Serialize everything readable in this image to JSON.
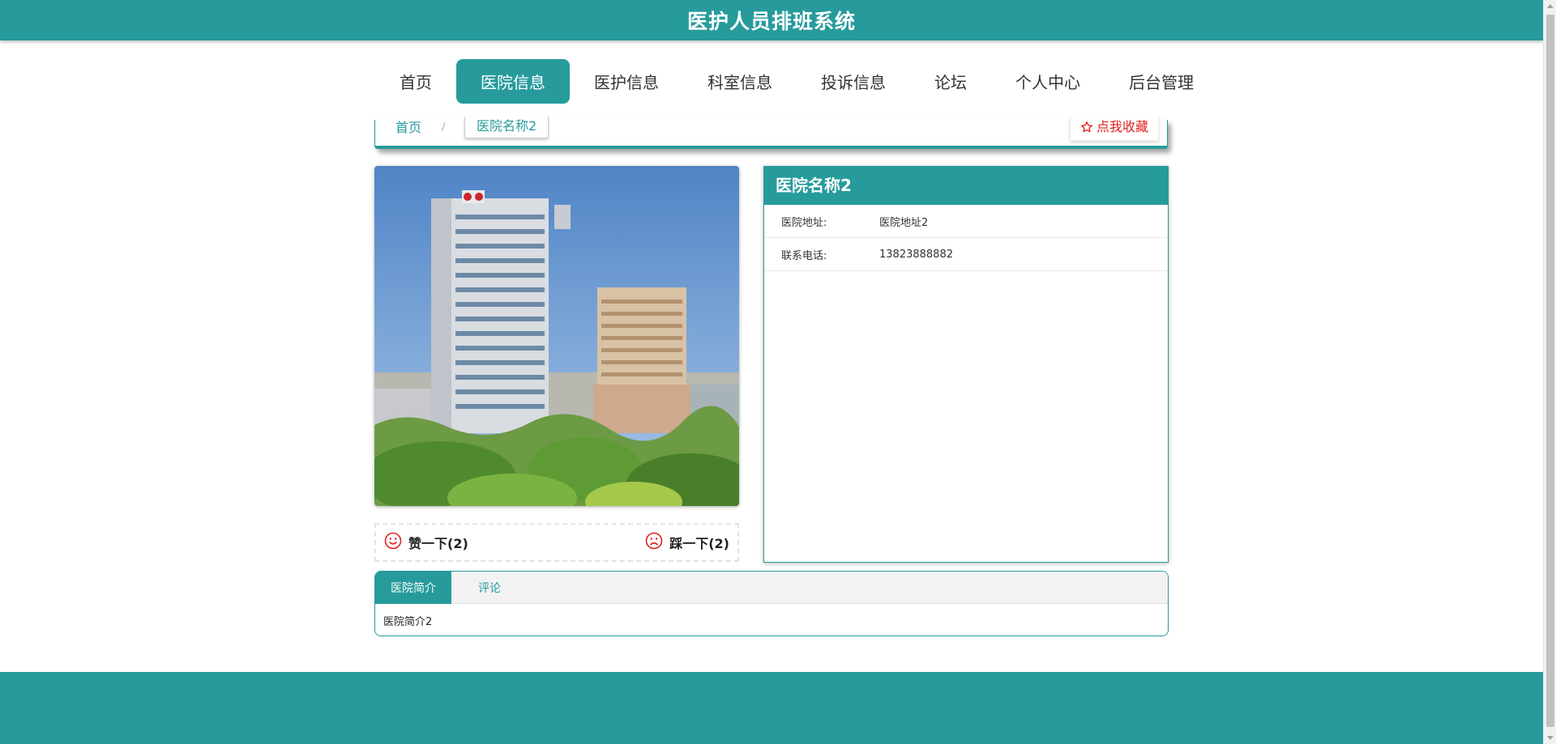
{
  "app": {
    "title": "医护人员排班系统"
  },
  "nav": {
    "items": [
      {
        "label": "首页"
      },
      {
        "label": "医院信息"
      },
      {
        "label": "医护信息"
      },
      {
        "label": "科室信息"
      },
      {
        "label": "投诉信息"
      },
      {
        "label": "论坛"
      },
      {
        "label": "个人中心"
      },
      {
        "label": "后台管理"
      }
    ],
    "active_index": 1
  },
  "breadcrumb": {
    "home": "首页",
    "separator": "/",
    "current": "医院名称2"
  },
  "favorite": {
    "label": "点我收藏",
    "icon": "star-outline-icon"
  },
  "votes": {
    "like": {
      "label": "赞一下(2)",
      "icon": "smile-icon"
    },
    "dislike": {
      "label": "踩一下(2)",
      "icon": "frown-icon"
    }
  },
  "detail": {
    "name": "医院名称2",
    "fields": [
      {
        "label": "医院地址:",
        "value": "医院地址2"
      },
      {
        "label": "联系电话:",
        "value": "13823888882"
      }
    ]
  },
  "tabs": {
    "items": [
      {
        "label": "医院简介"
      },
      {
        "label": "评论"
      }
    ],
    "active_index": 0,
    "content": "医院简介2"
  },
  "colors": {
    "primary": "#279b9c",
    "accent_red": "#e02020"
  }
}
